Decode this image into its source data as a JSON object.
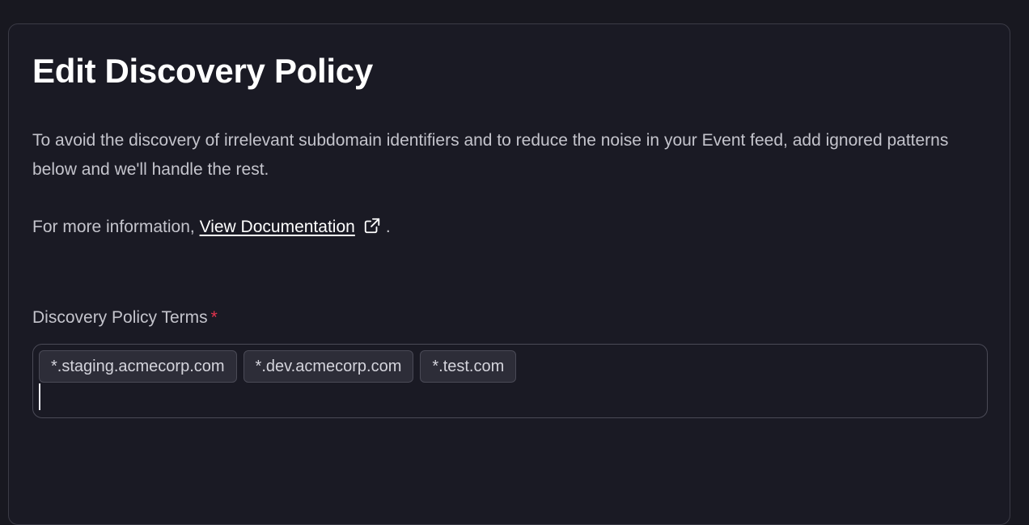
{
  "page": {
    "title": "Edit Discovery Policy",
    "description": "To avoid the discovery of irrelevant subdomain identifiers and to reduce the noise in your Event feed, add ignored patterns below and we'll handle the rest.",
    "more_info_prefix": "For more information, ",
    "doc_link_label": "View Documentation",
    "more_info_suffix": ".",
    "doc_link_icon": "external-link-icon"
  },
  "field": {
    "label": "Discovery Policy Terms",
    "required_marker": "*",
    "required_color": "#e5344e",
    "terms": [
      "*.staging.acmecorp.com",
      "*.dev.acmecorp.com",
      "*.test.com"
    ],
    "value": ""
  },
  "colors": {
    "background": "#181820",
    "panel": "#1a1a24",
    "text": "#c4c4cc",
    "title": "#ffffff",
    "tag_bg": "#2d2d38"
  }
}
